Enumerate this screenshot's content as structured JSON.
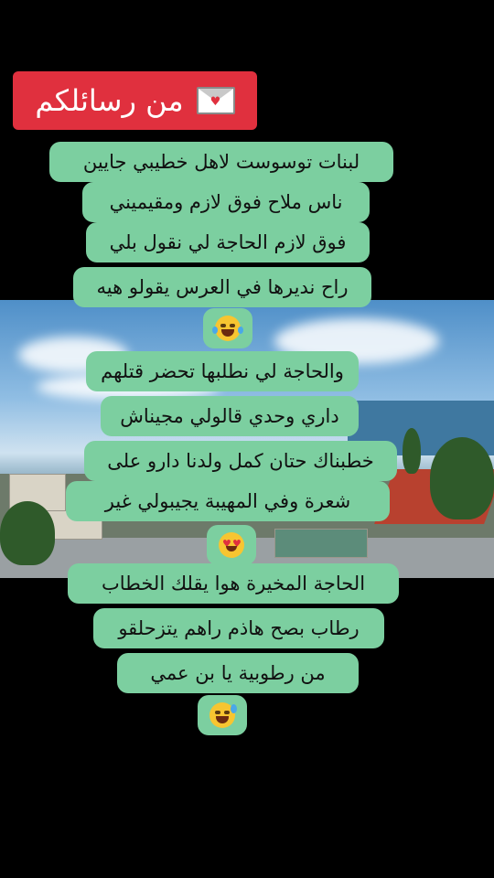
{
  "header": {
    "title": "من رسائلكم",
    "icon": "love-letter-icon",
    "color": "#e0303e"
  },
  "bubble_color": "#7ccfa0",
  "lines": [
    "لبنات توسوست لاهل خطيبي جايين",
    "ناس ملاح فوق لازم ومقيميني",
    "فوق لازم الحاجة لي نقول بلي",
    "راح نديرها في العرس يقولو هيه",
    "والحاجة لي نطلبها تحضر قتلهم",
    "داري وحدي قالولي مجيناش",
    "خطبناك حتان كمل ولدنا دارو على",
    "شعرة وفي المهيبة يجيبولي غير",
    "الحاجة المخيرة هوا يقلك الخطاب",
    "رطاب بصح هاذم راهم يتزحلقو",
    "من رطوبية يا بن عمي"
  ],
  "emojis": [
    "laughing-tears-emoji",
    "heart-eyes-emoji",
    "sweat-smile-emoji"
  ]
}
